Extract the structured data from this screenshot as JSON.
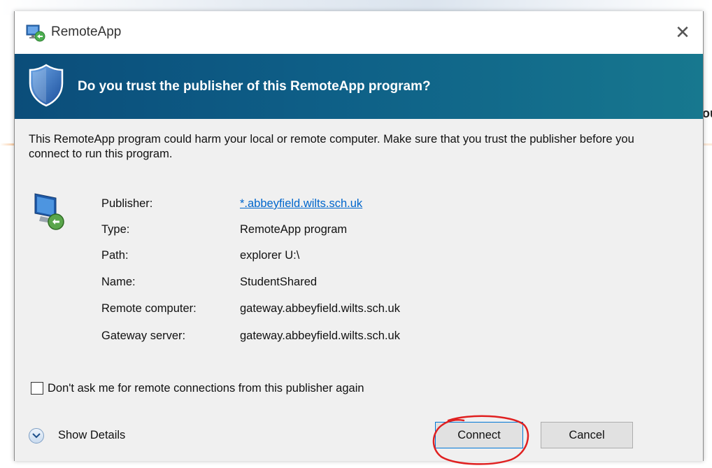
{
  "dialog": {
    "title": "RemoteApp",
    "banner_heading": "Do you trust the publisher of this RemoteApp program?",
    "warning_text": "This RemoteApp program could harm your local or remote computer. Make sure that you trust the publisher before you connect to run this program.",
    "fields": [
      {
        "label": "Publisher:",
        "value": "*.abbeyfield.wilts.sch.uk"
      },
      {
        "label": "Type:",
        "value": "RemoteApp program"
      },
      {
        "label": "Path:",
        "value": "explorer U:\\"
      },
      {
        "label": "Name:",
        "value": "StudentShared"
      },
      {
        "label": "Remote computer:",
        "value": "gateway.abbeyfield.wilts.sch.uk"
      },
      {
        "label": "Gateway server:",
        "value": "gateway.abbeyfield.wilts.sch.uk"
      }
    ],
    "checkbox_label": "Don't ask me for remote connections from this publisher again",
    "checkbox_checked": false,
    "show_details_label": "Show Details",
    "connect_label": "Connect",
    "cancel_label": "Cancel",
    "close_glyph": "✕"
  },
  "background": {
    "fragment_text": "ou"
  },
  "colors": {
    "banner": "#0e5f87",
    "link": "#0066cc",
    "annotation": "#e02020"
  },
  "icons": [
    "remoteapp-icon",
    "close-icon",
    "shield-icon",
    "computer-icon",
    "chevron-down-icon"
  ]
}
